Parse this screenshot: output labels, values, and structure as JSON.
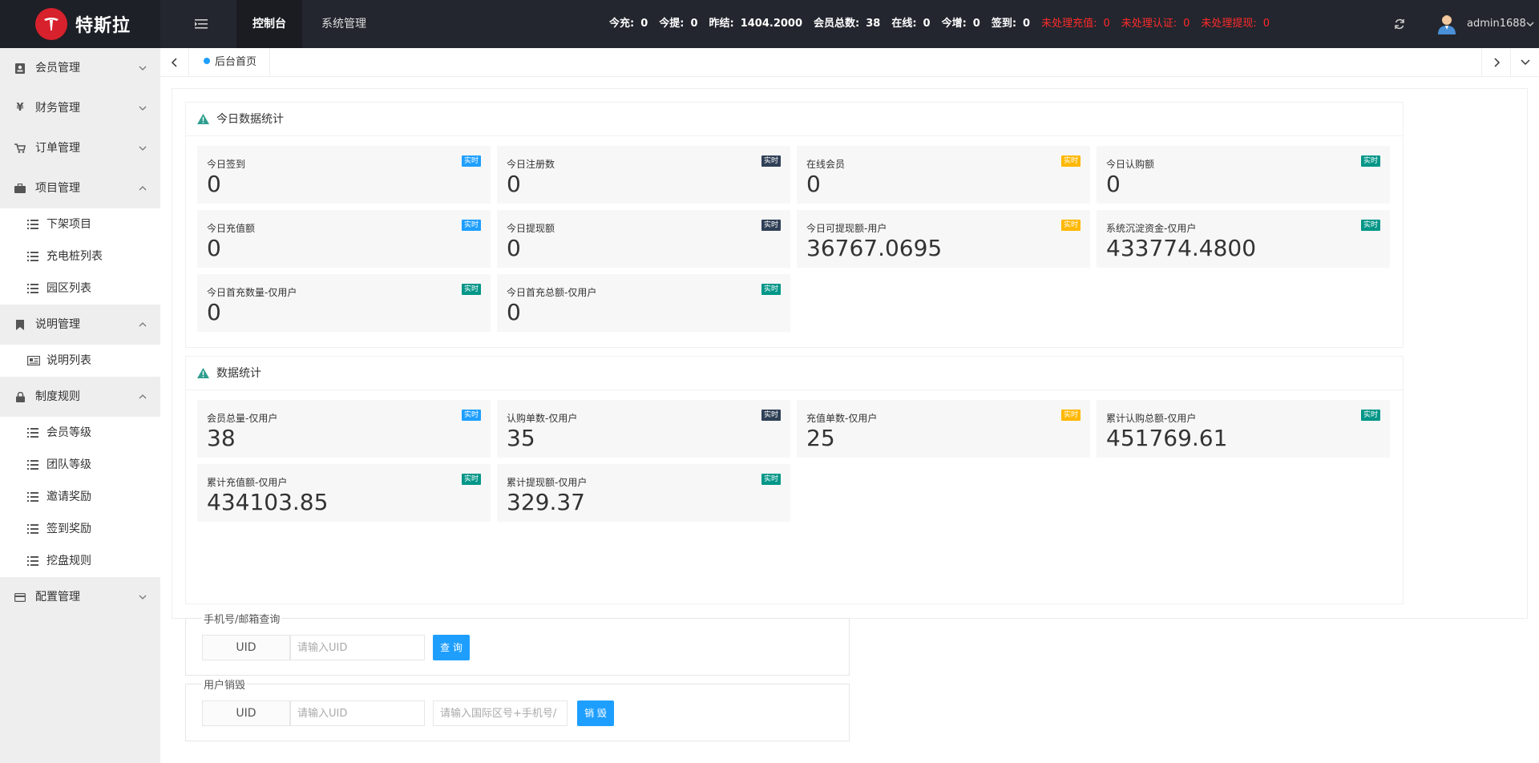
{
  "header": {
    "logo_text": "特斯拉",
    "logo_icon": "tesla-logo",
    "menu_icon": "menu-icon",
    "tabs": [
      {
        "label": "控制台",
        "active": true
      },
      {
        "label": "系统管理",
        "active": false
      }
    ],
    "stats": [
      {
        "label": "今充:",
        "value": "0",
        "red": false
      },
      {
        "label": "今提:",
        "value": "0",
        "red": false
      },
      {
        "label": "昨结:",
        "value": "1404.2000",
        "red": false
      },
      {
        "label": "会员总数:",
        "value": "38",
        "red": false
      },
      {
        "label": "在线:",
        "value": "0",
        "red": false
      },
      {
        "label": "今增:",
        "value": "0",
        "red": false
      },
      {
        "label": "签到:",
        "value": "0",
        "red": false
      },
      {
        "label": "未处理充值:",
        "value": "0",
        "red": true
      },
      {
        "label": "未处理认证:",
        "value": "0",
        "red": true
      },
      {
        "label": "未处理提现:",
        "value": "0",
        "red": true
      }
    ],
    "username": "admin1688",
    "accent_red": "#ff2a2a"
  },
  "sidebar": {
    "groups": [
      {
        "label": "会员管理",
        "icon": "member-card-icon",
        "expanded": false,
        "items": []
      },
      {
        "label": "财务管理",
        "icon": "yen-icon",
        "expanded": false,
        "items": []
      },
      {
        "label": "订单管理",
        "icon": "cart-icon",
        "expanded": false,
        "items": []
      },
      {
        "label": "项目管理",
        "icon": "briefcase-icon",
        "expanded": true,
        "items": [
          {
            "label": "下架项目",
            "icon": "list-icon"
          },
          {
            "label": "充电桩列表",
            "icon": "list-icon"
          },
          {
            "label": "园区列表",
            "icon": "list-icon"
          }
        ]
      },
      {
        "label": "说明管理",
        "icon": "bookmark-icon",
        "expanded": true,
        "items": [
          {
            "label": "说明列表",
            "icon": "newspaper-icon"
          }
        ]
      },
      {
        "label": "制度规则",
        "icon": "lock-icon",
        "expanded": true,
        "items": [
          {
            "label": "会员等级",
            "icon": "list-icon"
          },
          {
            "label": "团队等级",
            "icon": "list-icon"
          },
          {
            "label": "邀请奖励",
            "icon": "list-icon"
          },
          {
            "label": "签到奖励",
            "icon": "list-icon"
          },
          {
            "label": "挖盘规则",
            "icon": "list-icon"
          }
        ]
      },
      {
        "label": "配置管理",
        "icon": "credit-card-icon",
        "expanded": false,
        "items": []
      }
    ]
  },
  "tabbar": {
    "home_label": "后台首页"
  },
  "today": {
    "title": "今日数据统计",
    "tiles": [
      {
        "label": "今日签到",
        "value": "0",
        "badge": "实时",
        "badge_color": "#1e9fff"
      },
      {
        "label": "今日注册数",
        "value": "0",
        "badge": "实时",
        "badge_color": "#2f4056"
      },
      {
        "label": "在线会员",
        "value": "0",
        "badge": "实时",
        "badge_color": "#ffb800"
      },
      {
        "label": "今日认购额",
        "value": "0",
        "badge": "实时",
        "badge_color": "#009688"
      },
      {
        "label": "今日充值额",
        "value": "0",
        "badge": "实时",
        "badge_color": "#1e9fff"
      },
      {
        "label": "今日提现额",
        "value": "0",
        "badge": "实时",
        "badge_color": "#2f4056"
      },
      {
        "label": "今日可提现额-用户",
        "value": "36767.0695",
        "badge": "实时",
        "badge_color": "#ffb800"
      },
      {
        "label": "系统沉淀资金-仅用户",
        "value": "433774.4800",
        "badge": "实时",
        "badge_color": "#009688"
      },
      {
        "label": "今日首充数量-仅用户",
        "value": "0",
        "badge": "实时",
        "badge_color": "#009688"
      },
      {
        "label": "今日首充总额-仅用户",
        "value": "0",
        "badge": "实时",
        "badge_color": "#009688"
      }
    ]
  },
  "totals": {
    "title": "数据统计",
    "tiles": [
      {
        "label": "会员总量-仅用户",
        "value": "38",
        "badge": "实时",
        "badge_color": "#1e9fff"
      },
      {
        "label": "认购单数-仅用户",
        "value": "35",
        "badge": "实时",
        "badge_color": "#2f4056"
      },
      {
        "label": "充值单数-仅用户",
        "value": "25",
        "badge": "实时",
        "badge_color": "#ffb800"
      },
      {
        "label": "累计认购总额-仅用户",
        "value": "451769.61",
        "badge": "实时",
        "badge_color": "#009688"
      },
      {
        "label": "累计充值额-仅用户",
        "value": "434103.85",
        "badge": "实时",
        "badge_color": "#009688"
      },
      {
        "label": "累计提现额-仅用户",
        "value": "329.37",
        "badge": "实时",
        "badge_color": "#009688"
      }
    ]
  },
  "query_form": {
    "legend": "手机号/邮箱查询",
    "label": "UID",
    "placeholder": "请输入UID",
    "button": "查 询"
  },
  "destroy_form": {
    "legend": "用户销毁",
    "label": "UID",
    "uid_placeholder": "请输入UID",
    "phone_placeholder": "请输入国际区号+手机号/",
    "button": "销 毁"
  }
}
